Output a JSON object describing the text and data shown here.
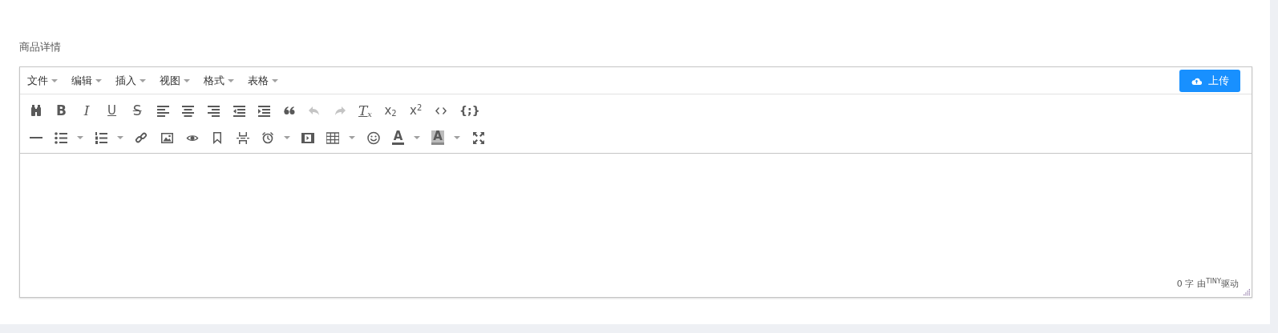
{
  "field_label": "商品详情",
  "editor": {
    "menus": [
      {
        "label": "文件"
      },
      {
        "label": "编辑"
      },
      {
        "label": "插入"
      },
      {
        "label": "视图"
      },
      {
        "label": "格式"
      },
      {
        "label": "表格"
      }
    ],
    "upload_button": {
      "label": "上传"
    },
    "toolbar_rows": [
      [
        {
          "kind": "find",
          "disabled": false,
          "dropdown": false
        },
        {
          "kind": "bold",
          "label": "B",
          "disabled": false,
          "dropdown": false
        },
        {
          "kind": "italic",
          "label": "I",
          "disabled": false,
          "dropdown": false
        },
        {
          "kind": "underline",
          "label": "U",
          "disabled": false,
          "dropdown": false
        },
        {
          "kind": "strike",
          "label": "S",
          "disabled": false,
          "dropdown": false
        },
        {
          "kind": "align-left",
          "disabled": false,
          "dropdown": false
        },
        {
          "kind": "align-center",
          "disabled": false,
          "dropdown": false
        },
        {
          "kind": "align-right",
          "disabled": false,
          "dropdown": false
        },
        {
          "kind": "outdent",
          "disabled": false,
          "dropdown": false
        },
        {
          "kind": "indent",
          "disabled": false,
          "dropdown": false
        },
        {
          "kind": "quote",
          "disabled": false,
          "dropdown": false
        },
        {
          "kind": "undo",
          "disabled": true,
          "dropdown": false
        },
        {
          "kind": "redo",
          "disabled": true,
          "dropdown": false
        },
        {
          "kind": "clear",
          "label": "T$_{x}$",
          "disabled": false,
          "dropdown": false
        },
        {
          "kind": "subscript",
          "label": "x$_{2}$",
          "disabled": false,
          "dropdown": false
        },
        {
          "kind": "superscript",
          "label": "x$^{2}$",
          "disabled": false,
          "dropdown": false
        },
        {
          "kind": "code",
          "disabled": false,
          "dropdown": false
        },
        {
          "kind": "codesample",
          "label": "{;}",
          "disabled": false,
          "dropdown": false
        }
      ],
      [
        {
          "kind": "hr",
          "disabled": false,
          "dropdown": false
        },
        {
          "kind": "bullets",
          "disabled": false,
          "dropdown": true
        },
        {
          "kind": "numbers",
          "disabled": false,
          "dropdown": true
        },
        {
          "kind": "link",
          "disabled": false,
          "dropdown": false
        },
        {
          "kind": "image",
          "disabled": false,
          "dropdown": false
        },
        {
          "kind": "eye",
          "disabled": false,
          "dropdown": false
        },
        {
          "kind": "bookmark",
          "disabled": false,
          "dropdown": false
        },
        {
          "kind": "pagebreak",
          "disabled": false,
          "dropdown": false
        },
        {
          "kind": "clock",
          "disabled": false,
          "dropdown": true
        },
        {
          "kind": "film",
          "disabled": false,
          "dropdown": false
        },
        {
          "kind": "table",
          "disabled": false,
          "dropdown": true
        },
        {
          "kind": "smiley",
          "disabled": false,
          "dropdown": false
        },
        {
          "kind": "forecolor",
          "label": "A",
          "color": "#595959",
          "disabled": false,
          "dropdown": true
        },
        {
          "kind": "backcolor",
          "label": "A",
          "color": "#bbbbbb",
          "disabled": false,
          "dropdown": true
        },
        {
          "kind": "fullscreen",
          "disabled": false,
          "dropdown": false
        }
      ]
    ],
    "word_count": "0 字",
    "powered_by": "由$^{TINY}$驱动"
  }
}
